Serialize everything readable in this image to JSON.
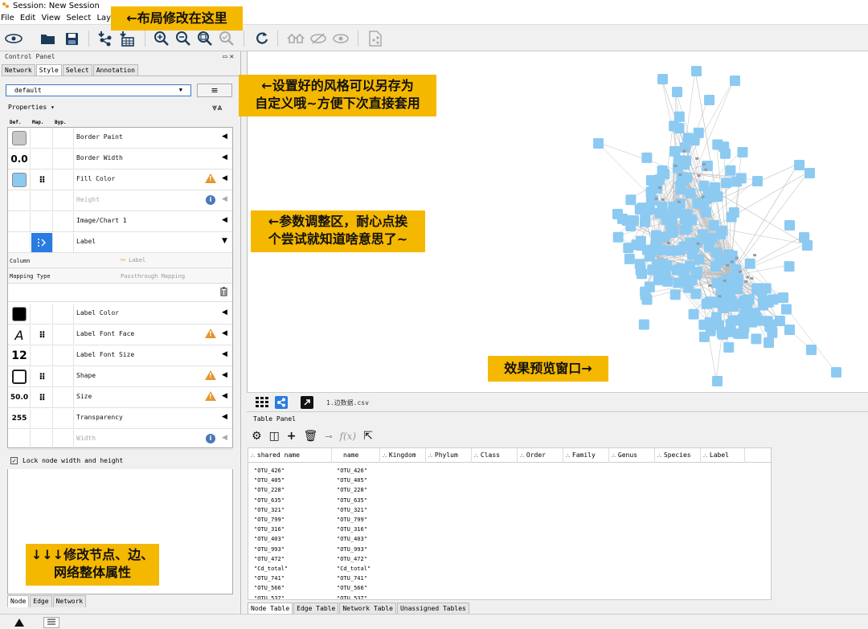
{
  "window": {
    "title": "Session: New Session"
  },
  "menubar": [
    "File",
    "Edit",
    "View",
    "Select",
    "Layout"
  ],
  "annotations": {
    "layout_note": "←布局修改在这里",
    "style_note_1": "←设置好的风格可以另存为",
    "style_note_2": "自定义哦~方便下次直接套用",
    "param_note_1": "←参数调整区，耐心点挨",
    "param_note_2": "个尝试就知道啥意思了~",
    "preview_note": "效果预览窗口→",
    "bottom_note_1": "↓↓↓修改节点、边、",
    "bottom_note_2": "网络整体属性"
  },
  "control_panel": {
    "title": "Control Panel",
    "window_buttons": "▭✕",
    "tabs": [
      "Network",
      "Style",
      "Select",
      "Annotation"
    ],
    "active_tab": "Style",
    "style_select": "default",
    "menu_button": "≡",
    "properties_label": "Properties ▾",
    "collapse_expand": "⩔⩓",
    "col_headers": {
      "def": "Def.",
      "map": "Map.",
      "byp": "Byp."
    },
    "properties": [
      {
        "name": "Border Paint",
        "def": "",
        "swatch": "#c8c8c8",
        "map": "",
        "warn": false,
        "info": false,
        "dim": false
      },
      {
        "name": "Border Width",
        "def": "0.0",
        "swatch": "",
        "map": "",
        "warn": false,
        "info": false,
        "dim": false
      },
      {
        "name": "Fill Color",
        "def": "",
        "swatch": "#8ccaf2",
        "map": "⠿",
        "warn": true,
        "info": false,
        "dim": false
      },
      {
        "name": "Height",
        "def": "",
        "swatch": "",
        "map": "",
        "warn": false,
        "info": true,
        "dim": true
      },
      {
        "name": "Image/Chart 1",
        "def": "",
        "swatch": "",
        "map": "",
        "warn": false,
        "info": false,
        "dim": false
      },
      {
        "name": "Label",
        "def": "",
        "swatch": "",
        "map": "pass",
        "warn": false,
        "info": false,
        "dim": false
      }
    ],
    "label_mapping": {
      "column_label": "Column",
      "column_value": "Label",
      "type_label": "Mapping Type",
      "type_value": "Passthrough Mapping"
    },
    "properties2": [
      {
        "name": "Label Color",
        "def": "",
        "swatch": "#000000",
        "map": "",
        "warn": false,
        "info": false,
        "dim": false
      },
      {
        "name": "Label Font Face",
        "def": "A",
        "swatch": "",
        "map": "⠿",
        "warn": true,
        "info": false,
        "dim": false
      },
      {
        "name": "Label Font Size",
        "def": "12",
        "swatch": "",
        "map": "",
        "warn": false,
        "info": false,
        "dim": false
      },
      {
        "name": "Shape",
        "def": "",
        "swatch": "shape",
        "map": "⠿",
        "warn": true,
        "info": false,
        "dim": false
      },
      {
        "name": "Size",
        "def": "50.0",
        "swatch": "",
        "map": "⠿",
        "warn": true,
        "info": false,
        "dim": false
      },
      {
        "name": "Transparency",
        "def": "255",
        "swatch": "",
        "map": "",
        "warn": false,
        "info": false,
        "dim": false
      },
      {
        "name": "Width",
        "def": "",
        "swatch": "",
        "map": "",
        "warn": false,
        "info": true,
        "dim": true
      }
    ],
    "lock_label": "Lock node width and height",
    "bottom_tabs": [
      "Node",
      "Edge",
      "Network"
    ]
  },
  "network_view": {
    "file_tab": "1.边数据.csv",
    "node_color": "#8ccaf2"
  },
  "table_panel": {
    "title": "Table Panel",
    "fx_label": "f(x)",
    "columns": [
      "shared name",
      "name",
      "Kingdom",
      "Phylum",
      "Class",
      "Order",
      "Family",
      "Genus",
      "Species",
      "Label"
    ],
    "rows": [
      [
        "\"OTU_426\"",
        "\"OTU_426\""
      ],
      [
        "\"OTU_405\"",
        "\"OTU_405\""
      ],
      [
        "\"OTU_228\"",
        "\"OTU_228\""
      ],
      [
        "\"OTU_635\"",
        "\"OTU_635\""
      ],
      [
        "\"OTU_321\"",
        "\"OTU_321\""
      ],
      [
        "\"OTU_799\"",
        "\"OTU_799\""
      ],
      [
        "\"OTU_316\"",
        "\"OTU_316\""
      ],
      [
        "\"OTU_403\"",
        "\"OTU_403\""
      ],
      [
        "\"OTU_993\"",
        "\"OTU_993\""
      ],
      [
        "\"OTU_472\"",
        "\"OTU_472\""
      ],
      [
        "\"Cd_total\"",
        "\"Cd_total\""
      ],
      [
        "\"OTU_741\"",
        "\"OTU_741\""
      ],
      [
        "\"OTU_566\"",
        "\"OTU_566\""
      ],
      [
        "\"OTU_537\"",
        "\"OTU_537\""
      ]
    ],
    "tabs": [
      "Node Table",
      "Edge Table",
      "Network Table",
      "Unassigned Tables"
    ]
  }
}
